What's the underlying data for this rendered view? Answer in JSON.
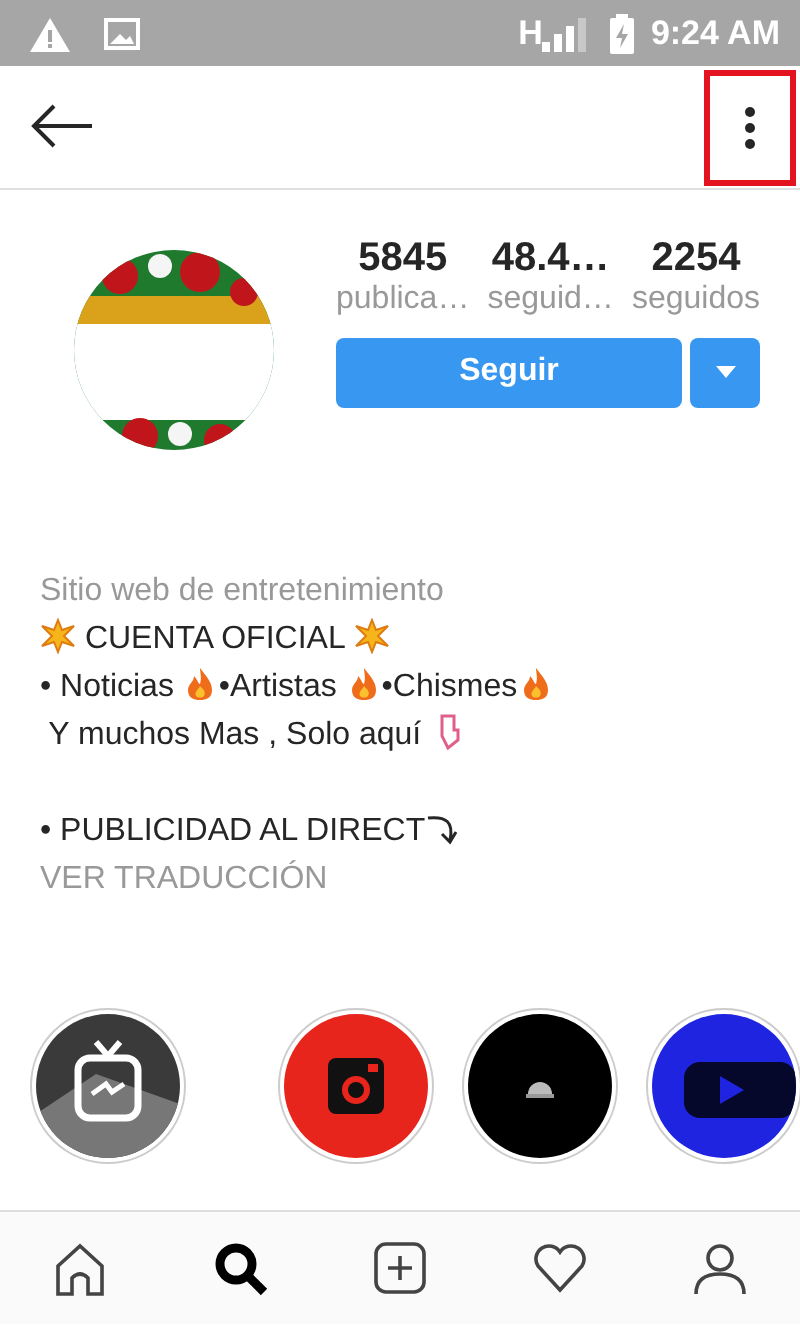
{
  "status_bar": {
    "network": "H",
    "time": "9:24 AM"
  },
  "stats": [
    {
      "value": "5845",
      "label": "publica…"
    },
    {
      "value": "48.4…",
      "label": "seguid…"
    },
    {
      "value": "2254",
      "label": "seguidos"
    }
  ],
  "follow_button": "Seguir",
  "bio": {
    "category": "Sitio web de entretenimiento",
    "paragraphs": [
      [
        [
          {
            "kind": "burst"
          },
          {
            "kind": "text",
            "text": " CUENTA OFICIAL "
          },
          {
            "kind": "burst"
          }
        ],
        [
          {
            "kind": "text",
            "text": "• Noticias "
          },
          {
            "kind": "flame"
          },
          {
            "kind": "text",
            "text": "•Artistas "
          },
          {
            "kind": "flame"
          },
          {
            "kind": "text",
            "text": "•Chismes"
          },
          {
            "kind": "flame"
          }
        ],
        [
          {
            "kind": "text",
            "text": " Y muchos Mas , Solo aquí "
          },
          {
            "kind": "pointer"
          }
        ]
      ],
      [
        [
          {
            "kind": "text",
            "text": "• PUBLICIDAD AL DIRECT"
          },
          {
            "kind": "arrow"
          }
        ]
      ]
    ],
    "translate_link": "VER TRADUCCIÓN"
  },
  "highlights": [
    {
      "kind": "tv"
    },
    {
      "kind": "camera"
    },
    {
      "kind": "dark"
    },
    {
      "kind": "video"
    }
  ],
  "bottom_nav": [
    {
      "kind": "home",
      "selected": false
    },
    {
      "kind": "search",
      "selected": true
    },
    {
      "kind": "add",
      "selected": false
    },
    {
      "kind": "heart",
      "selected": false
    },
    {
      "kind": "profile",
      "selected": false
    }
  ]
}
